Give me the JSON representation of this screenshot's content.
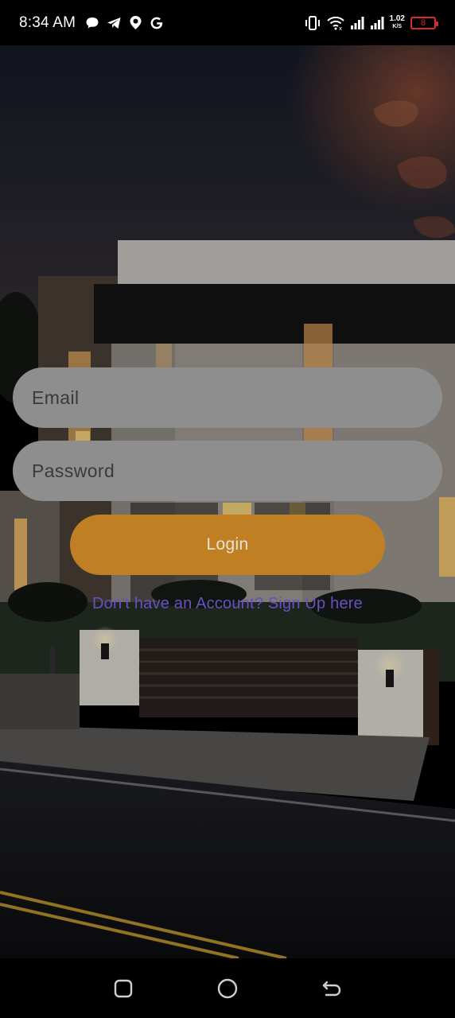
{
  "status_bar": {
    "time": "8:34 AM",
    "left_icons": [
      "chat-bubble-icon",
      "telegram-icon",
      "location-pin-icon",
      "google-icon"
    ],
    "right_icons": [
      "vibrate-icon",
      "wifi-icon",
      "signal-icon",
      "signal-icon-2"
    ],
    "speed_value": "1.02",
    "speed_unit": "K/S",
    "battery_level": "8",
    "battery_color": "#d32f2f"
  },
  "form": {
    "email_placeholder": "Email",
    "password_placeholder": "Password",
    "login_label": "Login",
    "signup_text": "Don't have an Account? Sign Up here"
  },
  "colors": {
    "field_bg": "#8e8e8e",
    "button_bg": "#c07f22",
    "link": "#6a4fc2"
  },
  "nav_bar": {
    "icons": [
      "recents-icon",
      "home-icon",
      "back-icon"
    ]
  }
}
